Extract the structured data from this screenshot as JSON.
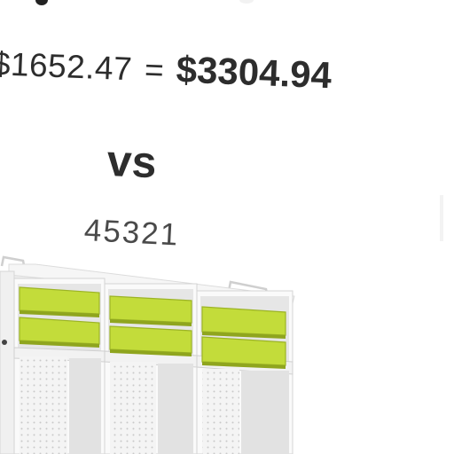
{
  "calculation": {
    "original_price": "$1652.47",
    "equals_sign": "=",
    "total_price": "$3304.94"
  },
  "comparison": {
    "separator": "vs",
    "product_code": "45321"
  },
  "product": {
    "type": "storage cabinet with tray drawers",
    "tray_color": "#c3dc3a",
    "tray_rows": 2,
    "bays": 3
  }
}
